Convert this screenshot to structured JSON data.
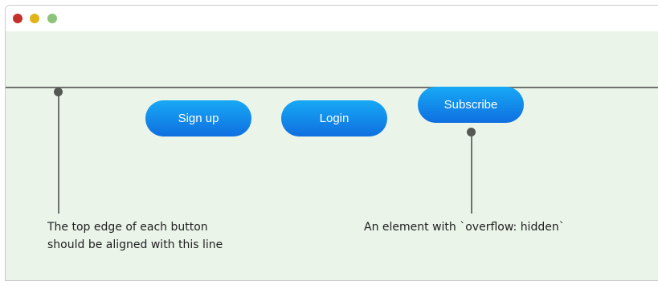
{
  "window": {
    "traffic_lights": [
      {
        "name": "close",
        "color": "#c4302b"
      },
      {
        "name": "minimize",
        "color": "#e1b41b"
      },
      {
        "name": "maximize",
        "color": "#8dc37a"
      }
    ],
    "content_background": "#eaf4e9"
  },
  "buttons": {
    "signup": {
      "label": "Sign up"
    },
    "login": {
      "label": "Login"
    },
    "subscribe": {
      "label": "Subscribe"
    },
    "gradient": [
      "#17a9f5",
      "#0f6fe0"
    ]
  },
  "annotations": {
    "left": {
      "line1": "The top edge of each button",
      "line2": "should be aligned with this line"
    },
    "right": {
      "line1": "An element with `overflow: hidden`"
    }
  }
}
